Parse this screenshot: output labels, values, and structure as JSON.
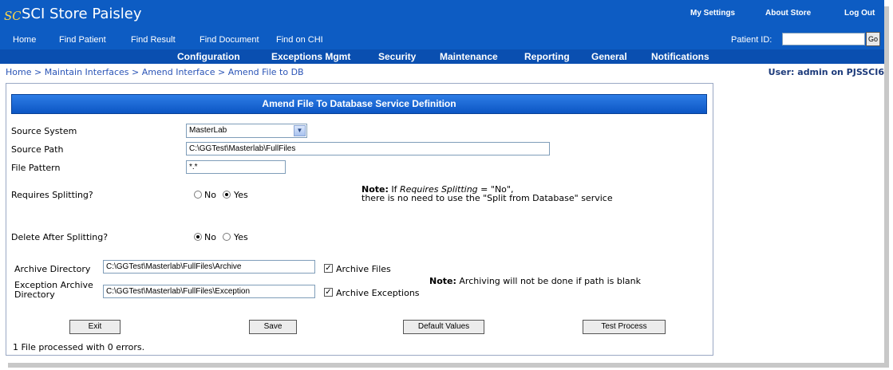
{
  "app": {
    "title": "SCI Store Paisley",
    "logo_text": "SCI"
  },
  "top_links": {
    "my_settings": "My Settings",
    "about_store": "About Store",
    "log_out": "Log Out"
  },
  "nav": {
    "home": "Home",
    "find_patient": "Find Patient",
    "find_result": "Find Result",
    "find_document": "Find Document",
    "find_on_chi": "Find on CHI",
    "patient_id_label": "Patient ID:",
    "patient_id_value": "",
    "go_label": "Go"
  },
  "menu": {
    "configuration": "Configuration",
    "exceptions_mgmt": "Exceptions Mgmt",
    "security": "Security",
    "maintenance": "Maintenance",
    "reporting": "Reporting",
    "general": "General",
    "notifications": "Notifications"
  },
  "breadcrumb": {
    "home": "Home",
    "maintain_interfaces": "Maintain Interfaces",
    "amend_interface": "Amend Interface",
    "current": "Amend File to DB",
    "separator": ">"
  },
  "user_info": "User: admin on PJSSCI6",
  "form": {
    "title": "Amend File To Database Service Definition",
    "source_system_label": "Source System",
    "source_system_value": "MasterLab",
    "source_path_label": "Source Path",
    "source_path_value": "C:\\GGTest\\Masterlab\\FullFiles",
    "file_pattern_label": "File Pattern",
    "file_pattern_value": "*.*",
    "requires_splitting_label": "Requires Splitting?",
    "requires_splitting_no": "No",
    "requires_splitting_yes": "Yes",
    "split_note_title": "Note:",
    "split_note_pre": " If ",
    "split_note_em": "Requires Splitting",
    "split_note_post": " = \"No\",",
    "split_note_line2": "there is no need to use the \"Split from Database\" service",
    "delete_after_label": "Delete After Splitting?",
    "delete_no": "No",
    "delete_yes": "Yes",
    "archive_dir_label": "Archive Directory",
    "archive_dir_value": "C:\\GGTest\\Masterlab\\FullFiles\\Archive",
    "archive_files_label": "Archive Files",
    "exception_dir_label_1": "Exception Archive",
    "exception_dir_label_2": "Directory",
    "exception_dir_value": "C:\\GGTest\\Masterlab\\FullFiles\\Exception",
    "archive_exceptions_label": "Archive Exceptions",
    "archive_note_title": "Note:",
    "archive_note_text": " Archiving will not be done if path is blank"
  },
  "buttons": {
    "exit": "Exit",
    "save": "Save",
    "default_values": "Default Values",
    "test_process": "Test Process"
  },
  "status": "1 File processed with 0 errors.",
  "state": {
    "requires_splitting": "Yes",
    "delete_after_splitting": "No",
    "archive_files": true,
    "archive_exceptions": true
  },
  "colors": {
    "header_blue": "#0d5cc3",
    "menu_blue": "#0a4fb0",
    "link_blue": "#2a54b6"
  }
}
